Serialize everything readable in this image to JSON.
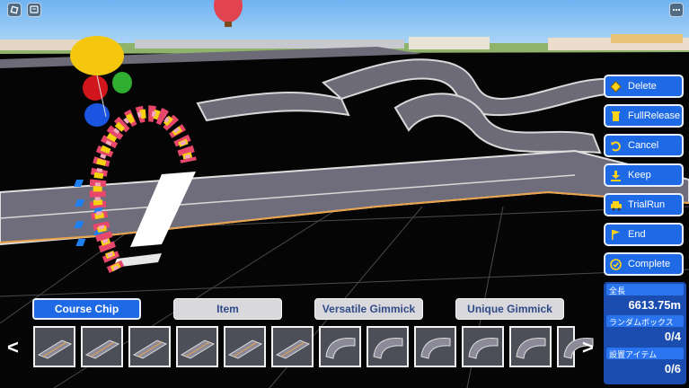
{
  "actions": [
    {
      "label": "Delete",
      "icon": "diamond-icon"
    },
    {
      "label": "FullRelease",
      "icon": "trash-icon"
    },
    {
      "label": "Cancel",
      "icon": "undo-icon"
    },
    {
      "label": "Keep",
      "icon": "download-icon"
    },
    {
      "label": "TrialRun",
      "icon": "car-icon"
    },
    {
      "label": "End",
      "icon": "flag-icon"
    },
    {
      "label": "Complete",
      "icon": "check-circle-icon"
    }
  ],
  "info": {
    "length_label": "全長",
    "length_value": "6613.75m",
    "random_box_label": "ランダムボックス",
    "random_box_value": "0/4",
    "placed_items_label": "設置アイテム",
    "placed_items_value": "0/6"
  },
  "tabs": [
    {
      "label": "Course Chip",
      "selected": true
    },
    {
      "label": "Item",
      "selected": false
    },
    {
      "label": "Versatile Gimmick",
      "selected": false
    },
    {
      "label": "Unique Gimmick",
      "selected": false
    }
  ],
  "chips": [
    "straight",
    "straight",
    "straight",
    "straight",
    "straight",
    "straight",
    "curve",
    "curve",
    "curve",
    "curve",
    "curve",
    "curve"
  ],
  "nav": {
    "prev": "<",
    "next": ">"
  },
  "colors": {
    "button_blue": "#1e6ae6",
    "panel_blue": "#1b4db0",
    "tab_gray": "#d9d9dd"
  }
}
